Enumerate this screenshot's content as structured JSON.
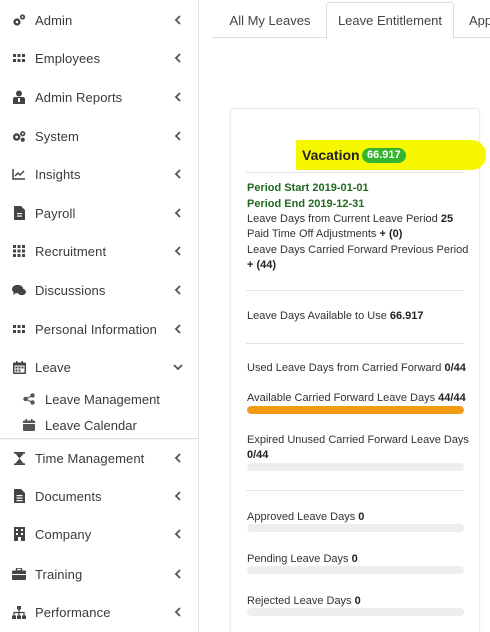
{
  "sidebar": {
    "items": [
      {
        "label": "Admin",
        "icon": "cogs-icon"
      },
      {
        "label": "Employees",
        "icon": "grid-icon"
      },
      {
        "label": "Admin Reports",
        "icon": "user-report-icon"
      },
      {
        "label": "System",
        "icon": "gears-icon"
      },
      {
        "label": "Insights",
        "icon": "line-chart-icon"
      },
      {
        "label": "Payroll",
        "icon": "file-icon"
      },
      {
        "label": "Recruitment",
        "icon": "grid-icon"
      },
      {
        "label": "Discussions",
        "icon": "comments-icon"
      },
      {
        "label": "Personal Information",
        "icon": "grid-icon"
      },
      {
        "label": "Leave",
        "icon": "calendar-icon"
      },
      {
        "label": "Time Management",
        "icon": "hourglass-icon"
      },
      {
        "label": "Documents",
        "icon": "document-icon"
      },
      {
        "label": "Company",
        "icon": "building-icon"
      },
      {
        "label": "Training",
        "icon": "briefcase-icon"
      },
      {
        "label": "Performance",
        "icon": "sitemap-icon"
      }
    ],
    "leave_sub": [
      {
        "label": "Leave Management",
        "icon": "share-icon"
      },
      {
        "label": "Leave Calendar",
        "icon": "calendar-icon"
      }
    ]
  },
  "tabs": [
    "All My Leaves",
    "Leave Entitlement",
    "App"
  ],
  "card": {
    "title": "Vacation",
    "badge": "66.917",
    "period_start": "Period Start 2019-01-01",
    "period_end": "Period End 2019-12-31",
    "current_label": "Leave Days from Current Leave Period ",
    "current_value": "25",
    "pto_label": "Paid Time Off Adjustments ",
    "pto_value": "+ (0)",
    "cf_prev_label": "Leave Days Carried Forward Previous Period",
    "cf_prev_value": "+ (44)",
    "available_label": "Leave Days Available to Use ",
    "available_value": "66.917",
    "used_cf_label": "Used Leave Days from Carried Forward ",
    "used_cf_value": "0/44",
    "avail_cf_label": "Available Carried Forward Leave Days ",
    "avail_cf_value": "44/44",
    "avail_cf_progress": 1.0,
    "expired_label": "Expired Unused Carried Forward Leave Days",
    "expired_value": "0/44",
    "approved_label": "Approved Leave Days ",
    "approved_value": "0",
    "pending_label": "Pending Leave Days ",
    "pending_value": "0",
    "rejected_label": "Rejected Leave Days ",
    "rejected_value": "0"
  },
  "colors": {
    "highlight": "#f7f700",
    "badge": "#33b52e",
    "progress": "#f39c12",
    "period_text": "#1f6b1f"
  }
}
